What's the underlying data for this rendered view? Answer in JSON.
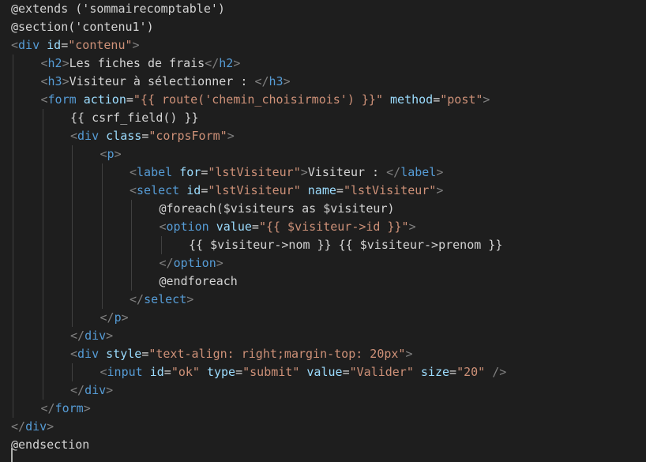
{
  "editor": {
    "colors": {
      "background": "#1e1e1e",
      "text": "#d4d4d4",
      "tag": "#569cd6",
      "punctuation": "#808080",
      "attribute": "#9cdcfe",
      "string": "#ce9178",
      "indent_guide": "#404040"
    },
    "lines": [
      {
        "indent": 0,
        "tokens": [
          {
            "t": "@extends ('sommairecomptable')",
            "c": "text"
          }
        ]
      },
      {
        "indent": 0,
        "tokens": [
          {
            "t": "@section('contenu1')",
            "c": "text"
          }
        ]
      },
      {
        "indent": 0,
        "tokens": [
          {
            "t": "<",
            "c": "punct"
          },
          {
            "t": "div",
            "c": "tag"
          },
          {
            "t": " ",
            "c": "text"
          },
          {
            "t": "id",
            "c": "attr"
          },
          {
            "t": "=",
            "c": "text"
          },
          {
            "t": "\"contenu\"",
            "c": "string"
          },
          {
            "t": ">",
            "c": "punct"
          }
        ]
      },
      {
        "indent": 1,
        "tokens": [
          {
            "t": "<",
            "c": "punct"
          },
          {
            "t": "h2",
            "c": "tag"
          },
          {
            "t": ">",
            "c": "punct"
          },
          {
            "t": "Les fiches de frais",
            "c": "text"
          },
          {
            "t": "</",
            "c": "punct"
          },
          {
            "t": "h2",
            "c": "tag"
          },
          {
            "t": ">",
            "c": "punct"
          }
        ]
      },
      {
        "indent": 1,
        "tokens": [
          {
            "t": "<",
            "c": "punct"
          },
          {
            "t": "h3",
            "c": "tag"
          },
          {
            "t": ">",
            "c": "punct"
          },
          {
            "t": "Visiteur à sélectionner : ",
            "c": "text"
          },
          {
            "t": "</",
            "c": "punct"
          },
          {
            "t": "h3",
            "c": "tag"
          },
          {
            "t": ">",
            "c": "punct"
          }
        ]
      },
      {
        "indent": 1,
        "tokens": [
          {
            "t": "<",
            "c": "punct"
          },
          {
            "t": "form",
            "c": "tag"
          },
          {
            "t": " ",
            "c": "text"
          },
          {
            "t": "action",
            "c": "attr"
          },
          {
            "t": "=",
            "c": "text"
          },
          {
            "t": "\"{{ route('chemin_choisirmois') }}\"",
            "c": "string"
          },
          {
            "t": " ",
            "c": "text"
          },
          {
            "t": "method",
            "c": "attr"
          },
          {
            "t": "=",
            "c": "text"
          },
          {
            "t": "\"post\"",
            "c": "string"
          },
          {
            "t": ">",
            "c": "punct"
          }
        ]
      },
      {
        "indent": 2,
        "tokens": [
          {
            "t": "{{ csrf_field() }}",
            "c": "text"
          }
        ]
      },
      {
        "indent": 2,
        "tokens": [
          {
            "t": "<",
            "c": "punct"
          },
          {
            "t": "div",
            "c": "tag"
          },
          {
            "t": " ",
            "c": "text"
          },
          {
            "t": "class",
            "c": "attr"
          },
          {
            "t": "=",
            "c": "text"
          },
          {
            "t": "\"corpsForm\"",
            "c": "string"
          },
          {
            "t": ">",
            "c": "punct"
          }
        ]
      },
      {
        "indent": 3,
        "tokens": [
          {
            "t": "<",
            "c": "punct"
          },
          {
            "t": "p",
            "c": "tag"
          },
          {
            "t": ">",
            "c": "punct"
          }
        ]
      },
      {
        "indent": 4,
        "tokens": [
          {
            "t": "<",
            "c": "punct"
          },
          {
            "t": "label",
            "c": "tag"
          },
          {
            "t": " ",
            "c": "text"
          },
          {
            "t": "for",
            "c": "attr"
          },
          {
            "t": "=",
            "c": "text"
          },
          {
            "t": "\"lstVisiteur\"",
            "c": "string"
          },
          {
            "t": ">",
            "c": "punct"
          },
          {
            "t": "Visiteur : ",
            "c": "text"
          },
          {
            "t": "</",
            "c": "punct"
          },
          {
            "t": "label",
            "c": "tag"
          },
          {
            "t": ">",
            "c": "punct"
          }
        ]
      },
      {
        "indent": 4,
        "tokens": [
          {
            "t": "<",
            "c": "punct"
          },
          {
            "t": "select",
            "c": "tag"
          },
          {
            "t": " ",
            "c": "text"
          },
          {
            "t": "id",
            "c": "attr"
          },
          {
            "t": "=",
            "c": "text"
          },
          {
            "t": "\"lstVisiteur\"",
            "c": "string"
          },
          {
            "t": " ",
            "c": "text"
          },
          {
            "t": "name",
            "c": "attr"
          },
          {
            "t": "=",
            "c": "text"
          },
          {
            "t": "\"lstVisiteur\"",
            "c": "string"
          },
          {
            "t": ">",
            "c": "punct"
          }
        ]
      },
      {
        "indent": 5,
        "tokens": [
          {
            "t": "@foreach($visiteurs as $visiteur)",
            "c": "text"
          }
        ]
      },
      {
        "indent": 5,
        "tokens": [
          {
            "t": "<",
            "c": "punct"
          },
          {
            "t": "option",
            "c": "tag"
          },
          {
            "t": " ",
            "c": "text"
          },
          {
            "t": "value",
            "c": "attr"
          },
          {
            "t": "=",
            "c": "text"
          },
          {
            "t": "\"{{ $visiteur->id }}\"",
            "c": "string"
          },
          {
            "t": ">",
            "c": "punct"
          }
        ]
      },
      {
        "indent": 6,
        "tokens": [
          {
            "t": "{{ $visiteur->nom }} {{ $visiteur->prenom }}",
            "c": "text"
          }
        ]
      },
      {
        "indent": 5,
        "tokens": [
          {
            "t": "</",
            "c": "punct"
          },
          {
            "t": "option",
            "c": "tag"
          },
          {
            "t": ">",
            "c": "punct"
          }
        ]
      },
      {
        "indent": 5,
        "tokens": [
          {
            "t": "@endforeach",
            "c": "text"
          }
        ]
      },
      {
        "indent": 4,
        "tokens": [
          {
            "t": "</",
            "c": "punct"
          },
          {
            "t": "select",
            "c": "tag"
          },
          {
            "t": ">",
            "c": "punct"
          }
        ]
      },
      {
        "indent": 3,
        "tokens": [
          {
            "t": "</",
            "c": "punct"
          },
          {
            "t": "p",
            "c": "tag"
          },
          {
            "t": ">",
            "c": "punct"
          }
        ]
      },
      {
        "indent": 2,
        "tokens": [
          {
            "t": "</",
            "c": "punct"
          },
          {
            "t": "div",
            "c": "tag"
          },
          {
            "t": ">",
            "c": "punct"
          }
        ]
      },
      {
        "indent": 2,
        "tokens": [
          {
            "t": "<",
            "c": "punct"
          },
          {
            "t": "div",
            "c": "tag"
          },
          {
            "t": " ",
            "c": "text"
          },
          {
            "t": "style",
            "c": "attr"
          },
          {
            "t": "=",
            "c": "text"
          },
          {
            "t": "\"text-align: right;margin-top: 20px\"",
            "c": "string"
          },
          {
            "t": ">",
            "c": "punct"
          }
        ]
      },
      {
        "indent": 3,
        "tokens": [
          {
            "t": "<",
            "c": "punct"
          },
          {
            "t": "input",
            "c": "tag"
          },
          {
            "t": " ",
            "c": "text"
          },
          {
            "t": "id",
            "c": "attr"
          },
          {
            "t": "=",
            "c": "text"
          },
          {
            "t": "\"ok\"",
            "c": "string"
          },
          {
            "t": " ",
            "c": "text"
          },
          {
            "t": "type",
            "c": "attr"
          },
          {
            "t": "=",
            "c": "text"
          },
          {
            "t": "\"submit\"",
            "c": "string"
          },
          {
            "t": " ",
            "c": "text"
          },
          {
            "t": "value",
            "c": "attr"
          },
          {
            "t": "=",
            "c": "text"
          },
          {
            "t": "\"Valider\"",
            "c": "string"
          },
          {
            "t": " ",
            "c": "text"
          },
          {
            "t": "size",
            "c": "attr"
          },
          {
            "t": "=",
            "c": "text"
          },
          {
            "t": "\"20\"",
            "c": "string"
          },
          {
            "t": " ",
            "c": "text"
          },
          {
            "t": "/>",
            "c": "punct"
          }
        ]
      },
      {
        "indent": 2,
        "tokens": [
          {
            "t": "</",
            "c": "punct"
          },
          {
            "t": "div",
            "c": "tag"
          },
          {
            "t": ">",
            "c": "punct"
          }
        ]
      },
      {
        "indent": 1,
        "tokens": [
          {
            "t": "</",
            "c": "punct"
          },
          {
            "t": "form",
            "c": "tag"
          },
          {
            "t": ">",
            "c": "punct"
          }
        ]
      },
      {
        "indent": 0,
        "tokens": [
          {
            "t": "</",
            "c": "punct"
          },
          {
            "t": "div",
            "c": "tag"
          },
          {
            "t": ">",
            "c": "punct"
          }
        ]
      },
      {
        "indent": 0,
        "tokens": [
          {
            "t": "@endsection",
            "c": "text"
          }
        ]
      }
    ]
  }
}
